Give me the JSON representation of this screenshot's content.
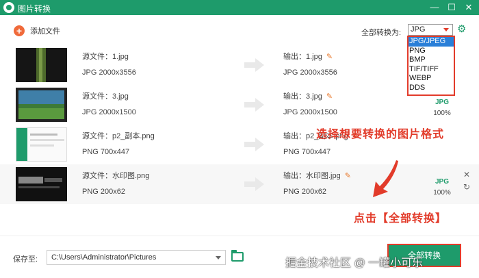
{
  "window": {
    "title": "图片转换",
    "minimize": "—",
    "maximize": "☐",
    "close": "✕"
  },
  "toolbar": {
    "add_label": "添加文件",
    "convert_all_label": "全部转换为:",
    "format_value": "JPG"
  },
  "dropdown": {
    "options": [
      "JPG/JPEG",
      "PNG",
      "BMP",
      "TIF/TIFF",
      "WEBP",
      "DDS"
    ]
  },
  "files": [
    {
      "src_name": "源文件：1.jpg",
      "src_meta": "JPG   2000x3556",
      "out_name": "输出：1.jpg",
      "out_meta": "JPG   2000x3556",
      "out_fmt": "",
      "out_pct": ""
    },
    {
      "src_name": "源文件：3.jpg",
      "src_meta": "JPG   2000x1500",
      "out_name": "输出：3.jpg",
      "out_meta": "JPG   2000x1500",
      "out_fmt": "JPG",
      "out_pct": "100%"
    },
    {
      "src_name": "源文件：p2_副本.png",
      "src_meta": "PNG   700x447",
      "out_name": "输出：p2_副本.png",
      "out_meta": "PNG   700x447",
      "out_fmt": "",
      "out_pct": ""
    },
    {
      "src_name": "源文件：水印图.png",
      "src_meta": "PNG   200x62",
      "out_name": "输出：水印图.jpg",
      "out_meta": "PNG   200x62",
      "out_fmt": "JPG",
      "out_pct": "100%"
    }
  ],
  "annotations": {
    "select_format": "选择想要转换的图片格式",
    "click_convert": "点击【全部转换】"
  },
  "bottom": {
    "save_label": "保存至:",
    "path": "C:\\Users\\Administrator\\Pictures",
    "convert_button": "全部转换",
    "watermark": "掘金技术社区 @ 一罐小可乐"
  },
  "colors": {
    "brand_green": "#1e9b6b",
    "annotation_red": "#e23b2a",
    "add_orange": "#f06a3a"
  }
}
